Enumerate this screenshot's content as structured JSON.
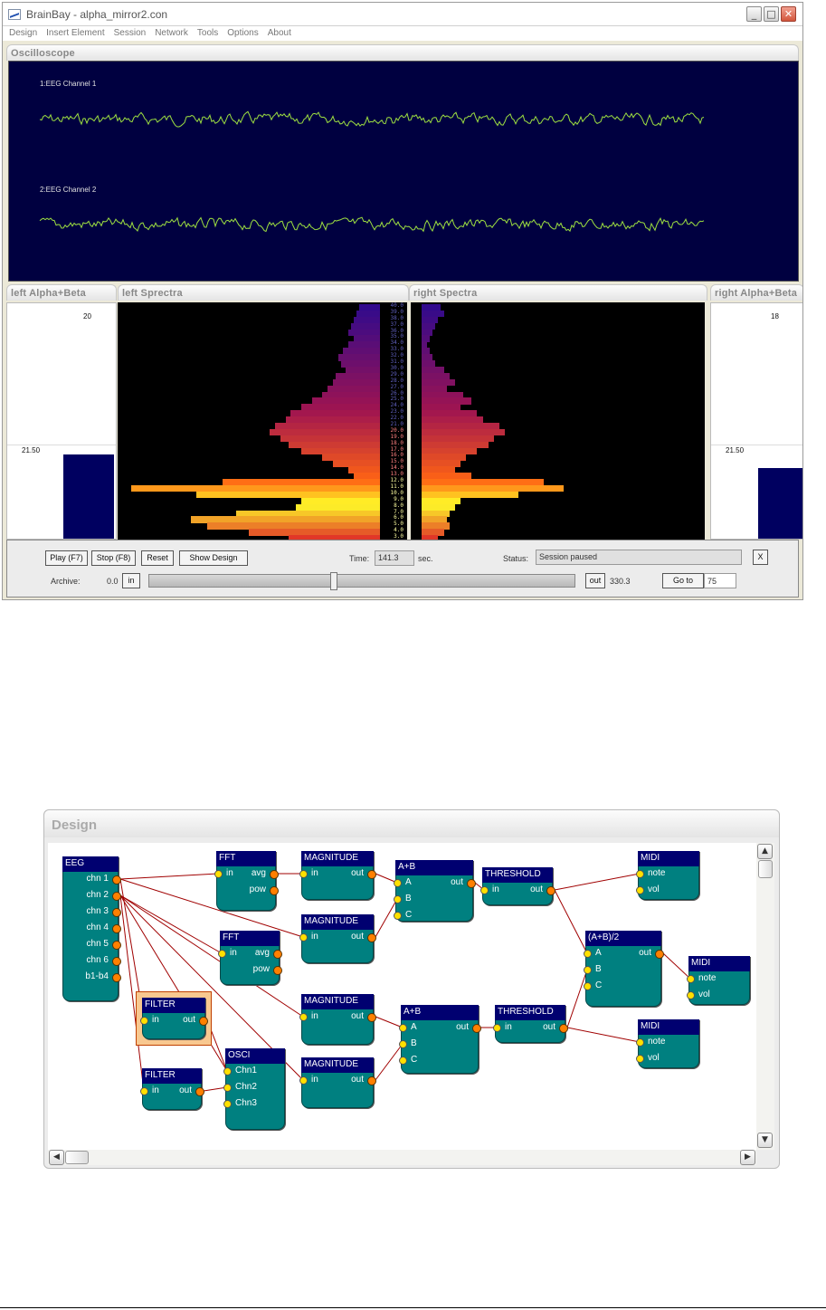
{
  "window": {
    "title": "BrainBay - alpha_mirror2.con",
    "minimize": "_",
    "maximize": "□",
    "close": "✕",
    "icon": "chart-app-icon"
  },
  "menu": [
    "Design",
    "Insert Element",
    "Session",
    "Network",
    "Tools",
    "Options",
    "About"
  ],
  "oscilloscope": {
    "title": "Oscilloscope",
    "channels": [
      "1:EEG Channel 1",
      "2:EEG Channel 2"
    ],
    "trace_color": "#9ee040"
  },
  "left_bar": {
    "title": "left Alpha+Beta",
    "max": "20",
    "threshold": "21.50",
    "level": 0.62
  },
  "right_bar": {
    "title": "right Alpha+Beta",
    "max": "18",
    "threshold": "21.50",
    "level": 0.52
  },
  "left_spectra": {
    "title": "left Sprectra"
  },
  "right_spectra": {
    "title": "right Spectra"
  },
  "spectra_labels": [
    "40.0",
    "39.0",
    "38.0",
    "37.0",
    "36.0",
    "35.0",
    "34.0",
    "33.0",
    "32.0",
    "31.0",
    "30.0",
    "29.0",
    "28.0",
    "27.0",
    "26.0",
    "25.0",
    "24.0",
    "23.0",
    "22.0",
    "21.0",
    "20.0",
    "19.0",
    "18.0",
    "17.0",
    "16.0",
    "15.0",
    "14.0",
    "13.0",
    "12.0",
    "11.0",
    "10.0",
    "9.0",
    "8.0",
    "7.0",
    "6.0",
    "5.0",
    "4.0",
    "3.0"
  ],
  "spectra_left_values": [
    0.08,
    0.09,
    0.1,
    0.11,
    0.12,
    0.1,
    0.12,
    0.14,
    0.16,
    0.15,
    0.13,
    0.17,
    0.18,
    0.2,
    0.22,
    0.26,
    0.3,
    0.34,
    0.36,
    0.4,
    0.42,
    0.38,
    0.35,
    0.3,
    0.22,
    0.18,
    0.12,
    0.1,
    0.6,
    0.95,
    0.7,
    0.3,
    0.32,
    0.55,
    0.72,
    0.66,
    0.5,
    0.35
  ],
  "spectra_right_values": [
    0.07,
    0.08,
    0.06,
    0.05,
    0.04,
    0.03,
    0.02,
    0.03,
    0.04,
    0.05,
    0.08,
    0.1,
    0.12,
    0.09,
    0.15,
    0.18,
    0.14,
    0.2,
    0.22,
    0.28,
    0.3,
    0.26,
    0.24,
    0.2,
    0.16,
    0.14,
    0.12,
    0.18,
    0.44,
    0.51,
    0.35,
    0.14,
    0.12,
    0.1,
    0.09,
    0.1,
    0.08,
    0.06
  ],
  "controls": {
    "play": "Play (F7)",
    "stop": "Stop (F8)",
    "reset": "Reset",
    "show_design": "Show Design",
    "time_label": "Time:",
    "time_value": "141.3",
    "time_unit": "sec.",
    "status_label": "Status:",
    "status_value": "Session paused",
    "status_close": "X",
    "archive_label": "Archive:",
    "archive_start": "0.0",
    "in": "in",
    "out": "out",
    "archive_end": "330.3",
    "goto": "Go to",
    "goto_value": "75",
    "position": 0.43
  },
  "design": {
    "title": "Design",
    "scroll_up": "▲",
    "scroll_down": "▼",
    "scroll_left": "◀",
    "scroll_right": "▶",
    "nodes": [
      {
        "id": "eeg",
        "title": "EEG",
        "inputs": [],
        "outputs": [
          "chn 1",
          "chn 2",
          "chn 3",
          "chn 4",
          "chn 5",
          "chn 6",
          "b1-b4"
        ]
      },
      {
        "id": "fft1",
        "title": "FFT",
        "inputs": [
          "in"
        ],
        "outputs": [
          "avg",
          "pow"
        ]
      },
      {
        "id": "fft2",
        "title": "FFT",
        "inputs": [
          "in"
        ],
        "outputs": [
          "avg",
          "pow"
        ]
      },
      {
        "id": "mag1",
        "title": "MAGNITUDE",
        "inputs": [
          "in"
        ],
        "outputs": [
          "out"
        ]
      },
      {
        "id": "mag2",
        "title": "MAGNITUDE",
        "inputs": [
          "in"
        ],
        "outputs": [
          "out"
        ]
      },
      {
        "id": "mag3",
        "title": "MAGNITUDE",
        "inputs": [
          "in"
        ],
        "outputs": [
          "out"
        ]
      },
      {
        "id": "mag4",
        "title": "MAGNITUDE",
        "inputs": [
          "in"
        ],
        "outputs": [
          "out"
        ]
      },
      {
        "id": "sum1",
        "title": "A+B",
        "inputs": [
          "A",
          "B",
          "C"
        ],
        "outputs": [
          "out"
        ]
      },
      {
        "id": "sum2",
        "title": "A+B",
        "inputs": [
          "A",
          "B",
          "C"
        ],
        "outputs": [
          "out"
        ]
      },
      {
        "id": "thr1",
        "title": "THRESHOLD",
        "inputs": [
          "in"
        ],
        "outputs": [
          "out"
        ]
      },
      {
        "id": "thr2",
        "title": "THRESHOLD",
        "inputs": [
          "in"
        ],
        "outputs": [
          "out"
        ]
      },
      {
        "id": "avg",
        "title": "(A+B)/2",
        "inputs": [
          "A",
          "B",
          "C"
        ],
        "outputs": [
          "out"
        ]
      },
      {
        "id": "midi1",
        "title": "MIDI",
        "inputs": [
          "note",
          "vol"
        ],
        "outputs": []
      },
      {
        "id": "midi2",
        "title": "MIDI",
        "inputs": [
          "note",
          "vol"
        ],
        "outputs": []
      },
      {
        "id": "midi3",
        "title": "MIDI",
        "inputs": [
          "note",
          "vol"
        ],
        "outputs": []
      },
      {
        "id": "filter1",
        "title": "FILTER",
        "inputs": [
          "in"
        ],
        "outputs": [
          "out"
        ],
        "selected": true
      },
      {
        "id": "filter2",
        "title": "FILTER",
        "inputs": [
          "in"
        ],
        "outputs": [
          "out"
        ]
      },
      {
        "id": "osci",
        "title": "OSCI",
        "inputs": [
          "Chn1",
          "Chn2",
          "Chn3"
        ],
        "outputs": []
      }
    ]
  }
}
